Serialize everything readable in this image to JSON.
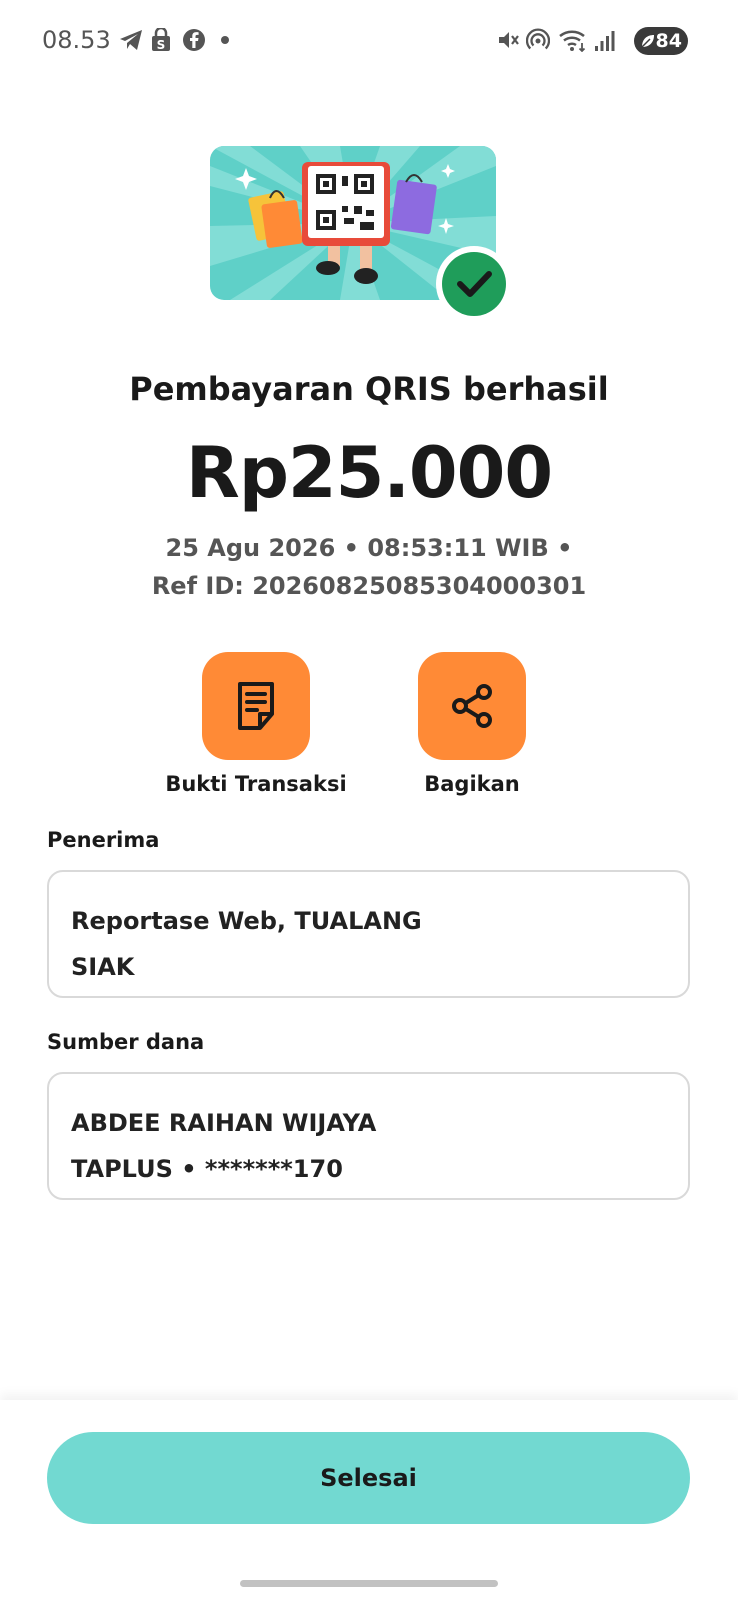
{
  "status_bar": {
    "time": "08.53",
    "battery": "84",
    "icons": [
      "telegram-icon",
      "shopping-bag-icon",
      "facebook-icon",
      "dot-icon",
      "mute-icon",
      "hotspot-icon",
      "wifi-icon",
      "signal-icon",
      "battery-icon"
    ]
  },
  "colors": {
    "accent_orange": "#ff8a36",
    "primary_button": "#72d9d1",
    "success_green": "#1f9d5a",
    "hero_teal": "#5fd0c8"
  },
  "result": {
    "title": "Pembayaran QRIS berhasil",
    "amount": "Rp25.000",
    "datetime": "25 Agu 2026 • 08:53:11 WIB •",
    "ref_id": "Ref ID: 20260825085304000301"
  },
  "actions": [
    {
      "label": "Bukti Transaksi",
      "icon": "receipt-icon"
    },
    {
      "label": "Bagikan",
      "icon": "share-icon"
    }
  ],
  "recipient": {
    "label": "Penerima",
    "line1": "Reportase Web, TUALANG",
    "line2": "SIAK"
  },
  "source": {
    "label": "Sumber dana",
    "line1": "ABDEE RAIHAN WIJAYA",
    "line2": "TAPLUS • *******170"
  },
  "footer": {
    "done_label": "Selesai"
  }
}
